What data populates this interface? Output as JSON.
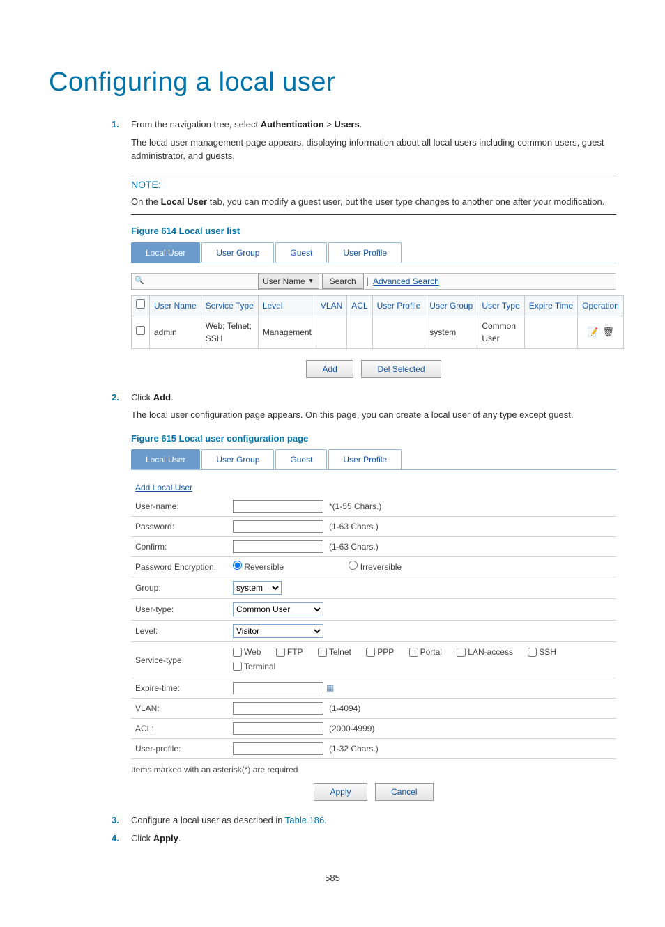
{
  "page_title": "Configuring a local user",
  "steps": {
    "s1_num": "1.",
    "s1_text_a": "From the navigation tree, select ",
    "s1_auth": "Authentication",
    "s1_gt": " > ",
    "s1_users": "Users",
    "s1_tail": ".",
    "s1_follow": "The local user management page appears, displaying information about all local users including common users, guest administrator, and guests.",
    "s2_num": "2.",
    "s2_text_a": "Click ",
    "s2_add": "Add",
    "s2_tail": ".",
    "s2_follow": "The local user configuration page appears. On this page, you can create a local user of any type except guest.",
    "s3_num": "3.",
    "s3_text": "Configure a local user as described in ",
    "s3_link": "Table 186",
    "s3_tail": ".",
    "s4_num": "4.",
    "s4_text_a": "Click ",
    "s4_apply": "Apply",
    "s4_tail": "."
  },
  "note": {
    "heading": "NOTE:",
    "body_a": "On the ",
    "body_b": "Local User",
    "body_c": " tab, you can modify a guest user, but the user type changes to another one after your modification."
  },
  "fig614": {
    "caption": "Figure 614 Local user list",
    "tabs": {
      "local_user": "Local User",
      "user_group": "User Group",
      "guest": "Guest",
      "user_profile": "User Profile"
    },
    "search": {
      "criteria": "User Name",
      "button": "Search",
      "advanced": "Advanced Search"
    },
    "table": {
      "headers": {
        "c0": "",
        "c1": "User Name",
        "c2": "Service Type",
        "c3": "Level",
        "c4": "VLAN",
        "c5": "ACL",
        "c6": "User Profile",
        "c7": "User Group",
        "c8": "User Type",
        "c9": "Expire Time",
        "c10": "Operation"
      },
      "row": {
        "user_name": "admin",
        "service_type": "Web; Telnet; SSH",
        "level": "Management",
        "vlan": "",
        "acl": "",
        "user_profile": "",
        "user_group": "system",
        "user_type": "Common User",
        "expire": ""
      }
    },
    "buttons": {
      "add": "Add",
      "del": "Del Selected"
    }
  },
  "fig615": {
    "caption": "Figure 615 Local user configuration page",
    "tabs": {
      "local_user": "Local User",
      "user_group": "User Group",
      "guest": "Guest",
      "user_profile": "User Profile"
    },
    "section": "Add Local User",
    "labels": {
      "username": "User-name:",
      "password": "Password:",
      "confirm": "Confirm:",
      "pwd_enc": "Password Encryption:",
      "group": "Group:",
      "usertype": "User-type:",
      "level": "Level:",
      "servicetype": "Service-type:",
      "expire": "Expire-time:",
      "vlan": "VLAN:",
      "acl": "ACL:",
      "userprofile": "User-profile:"
    },
    "hints": {
      "username": "*(1-55 Chars.)",
      "password": "(1-63 Chars.)",
      "confirm": "(1-63 Chars.)",
      "vlan": "(1-4094)",
      "acl": "(2000-4999)",
      "userprofile": "(1-32 Chars.)"
    },
    "enc": {
      "rev": "Reversible",
      "irrev": "Irreversible"
    },
    "selects": {
      "group": "system",
      "usertype": "Common User",
      "level": "Visitor"
    },
    "services": {
      "web": "Web",
      "ftp": "FTP",
      "telnet": "Telnet",
      "ppp": "PPP",
      "portal": "Portal",
      "lan": "LAN-access",
      "ssh": "SSH",
      "terminal": "Terminal"
    },
    "reqnote": "Items marked with an asterisk(*) are required",
    "buttons": {
      "apply": "Apply",
      "cancel": "Cancel"
    }
  },
  "pagenum": "585"
}
